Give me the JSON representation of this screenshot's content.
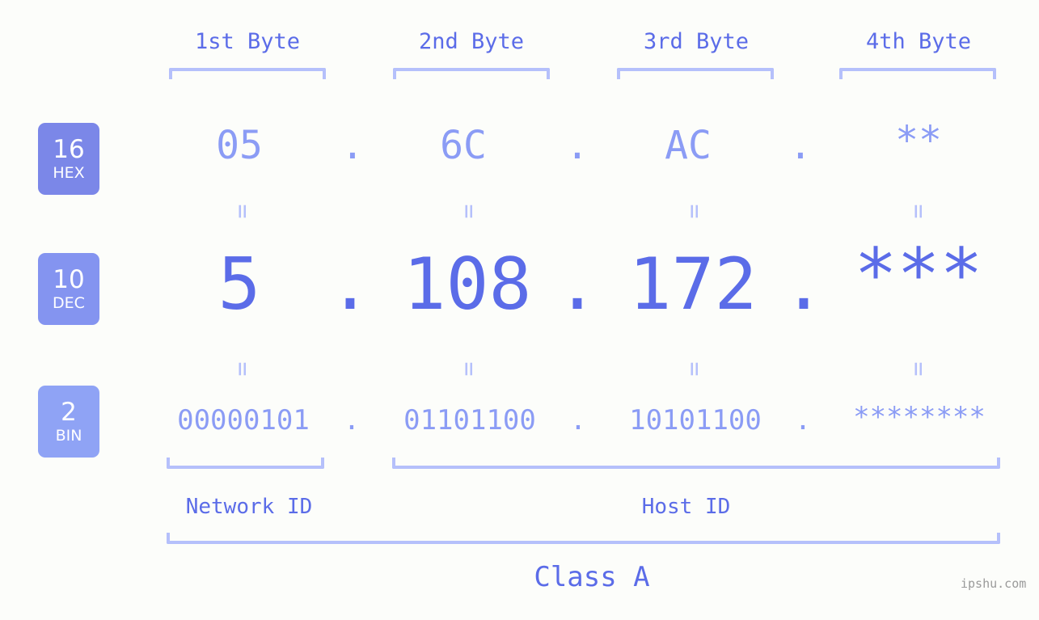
{
  "meta": {
    "background_color": "#fcfdfa",
    "accent_color": "#5b6ce8",
    "light_accent_color": "#8b9cf5",
    "bracket_color": "#b5c0fb",
    "watermark": "ipshu.com"
  },
  "byte_headers": [
    {
      "label": "1st Byte"
    },
    {
      "label": "2nd Byte"
    },
    {
      "label": "3rd Byte"
    },
    {
      "label": "4th Byte"
    }
  ],
  "bases": [
    {
      "num": "16",
      "name": "HEX",
      "color": "#7b87e8"
    },
    {
      "num": "10",
      "name": "DEC",
      "color": "#8494f0"
    },
    {
      "num": "2",
      "name": "BIN",
      "color": "#8fa3f5"
    }
  ],
  "rows": {
    "hex": {
      "base_num": "16",
      "base_name": "HEX",
      "values": [
        "05",
        "6C",
        "AC",
        "**"
      ],
      "separator": "."
    },
    "dec": {
      "base_num": "10",
      "base_name": "DEC",
      "values": [
        "5",
        "108",
        "172",
        "***"
      ],
      "separator": "."
    },
    "bin": {
      "base_num": "2",
      "base_name": "BIN",
      "values": [
        "00000101",
        "01101100",
        "10101100",
        "********"
      ],
      "separator": "."
    }
  },
  "equals_marks": {
    "glyph": "=",
    "hex_to_dec_count": 4,
    "dec_to_bin_count": 4
  },
  "segments": {
    "network_id": "Network ID",
    "host_id": "Host ID",
    "class": "Class A"
  }
}
